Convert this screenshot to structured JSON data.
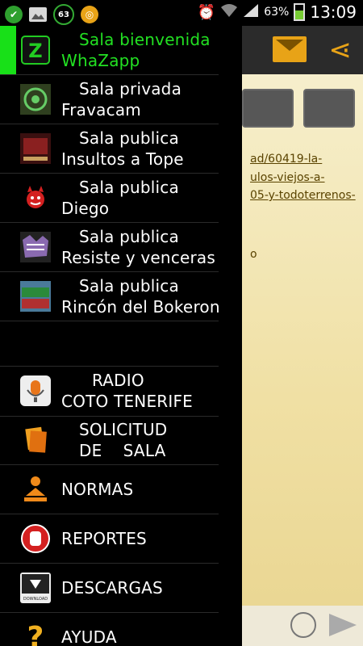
{
  "status_bar": {
    "notif_badge": "63",
    "battery": "63%",
    "time": "13:09"
  },
  "background": {
    "links": [
      "ad/60419-la-",
      "ulos-viejos-a-",
      "05-y-todoterrenos-",
      "o"
    ]
  },
  "rooms": [
    {
      "line1": "Sala bienvenida",
      "line2": "WhaZapp",
      "active": true,
      "icon": "whazapp-logo-icon"
    },
    {
      "line1": "Sala privada",
      "line2": "Fravacam",
      "active": false,
      "icon": "fravacam-icon"
    },
    {
      "line1": "Sala publica",
      "line2": "Insultos a Tope",
      "active": false,
      "icon": "insultos-thumbnail-icon"
    },
    {
      "line1": "Sala publica",
      "line2": "Diego",
      "active": false,
      "icon": "red-devil-icon"
    },
    {
      "line1": "Sala publica",
      "line2": "Resiste y venceras",
      "active": false,
      "icon": "resiste-thumbnail-icon"
    },
    {
      "line1": "Sala publica",
      "line2": "Rincón del Bokeron",
      "active": false,
      "icon": "bokeron-thumbnail-icon"
    }
  ],
  "radio": {
    "line1": "RADIO",
    "line2": "COTO TENERIFE"
  },
  "solicitud": {
    "line1": "SOLICITUD",
    "line2": "DE    SALA"
  },
  "tools": [
    {
      "label": "NORMAS",
      "icon": "rules-person-icon"
    },
    {
      "label": "REPORTES",
      "icon": "stop-hand-icon"
    },
    {
      "label": "DESCARGAS",
      "icon": "download-icon"
    },
    {
      "label": "AYUDA",
      "icon": "help-question-icon"
    }
  ],
  "download_icon_text": "DOWNLOAD",
  "colors": {
    "accent": "#22e022",
    "drawer_bg": "#000000",
    "orange": "#e8a317"
  }
}
